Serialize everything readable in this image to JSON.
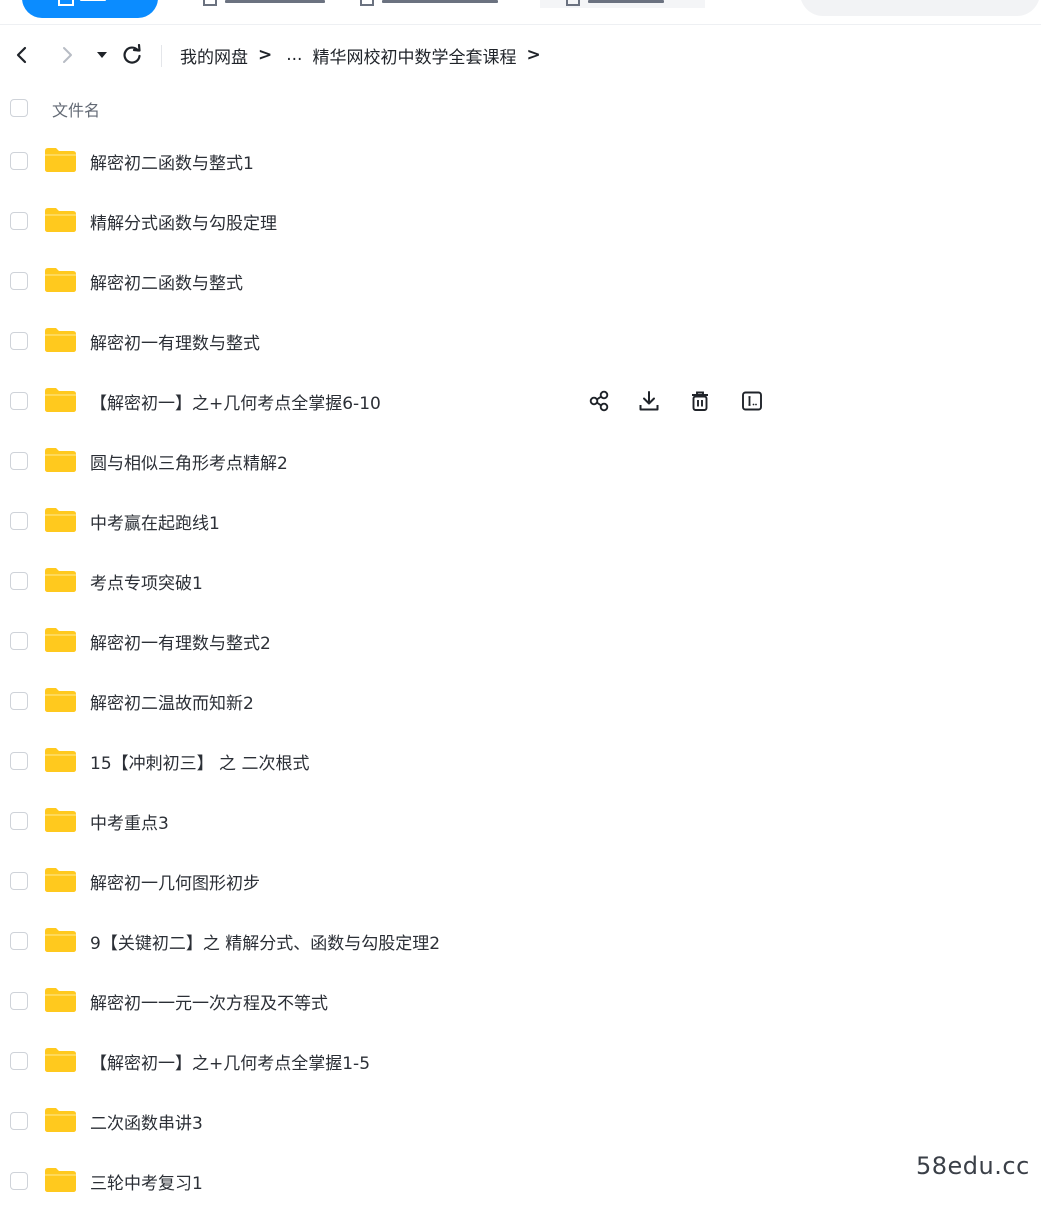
{
  "breadcrumb": {
    "root": "我的网盘",
    "ellipsis": "...",
    "current": "精华网校初中数学全套课程",
    "separator": ">"
  },
  "list": {
    "header_label": "文件名",
    "rows": [
      {
        "name": "解密初二函数与整式1"
      },
      {
        "name": "精解分式函数与勾股定理"
      },
      {
        "name": "解密初二函数与整式"
      },
      {
        "name": "解密初一有理数与整式"
      },
      {
        "name": "【解密初一】之+几何考点全掌握6-10"
      },
      {
        "name": "圆与相似三角形考点精解2"
      },
      {
        "name": "中考赢在起跑线1"
      },
      {
        "name": "考点专项突破1"
      },
      {
        "name": "解密初一有理数与整式2"
      },
      {
        "name": "解密初二温故而知新2"
      },
      {
        "name": "15【冲刺初三】 之 二次根式"
      },
      {
        "name": "中考重点3"
      },
      {
        "name": "解密初一几何图形初步"
      },
      {
        "name": "9【关键初二】之 精解分式、函数与勾股定理2"
      },
      {
        "name": "解密初一一元一次方程及不等式"
      },
      {
        "name": "【解密初一】之+几何考点全掌握1-5"
      },
      {
        "name": "二次函数串讲3"
      },
      {
        "name": "三轮中考复习1"
      }
    ]
  },
  "row_action_icons": [
    "share-icon",
    "download-icon",
    "delete-icon",
    "rename-icon"
  ],
  "watermark": "58edu.cc",
  "colors": {
    "accent": "#0b8cff",
    "folder": "#ffc91e",
    "folder_tab": "#ffd95a",
    "text": "#2b2f36",
    "muted_text": "#636a75",
    "checkbox_border": "#cfd3d9"
  }
}
